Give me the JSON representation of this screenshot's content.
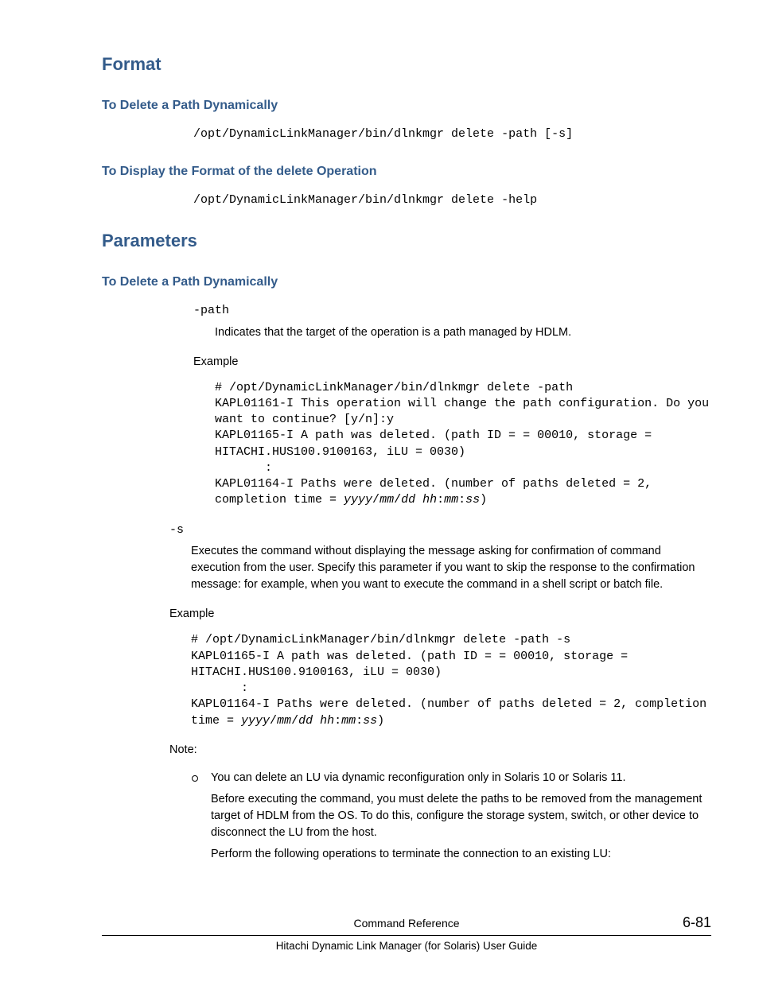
{
  "sections": {
    "format": {
      "title": "Format",
      "sub1": {
        "title": "To Delete a Path Dynamically",
        "code": "/opt/DynamicLinkManager/bin/dlnkmgr delete -path [-s]"
      },
      "sub2": {
        "title": "To Display the Format of the delete Operation",
        "code": "/opt/DynamicLinkManager/bin/dlnkmgr delete -help"
      }
    },
    "parameters": {
      "title": "Parameters",
      "sub1": {
        "title": "To Delete a Path Dynamically",
        "path": {
          "term": "-path",
          "desc": "Indicates that the target of the operation is a path managed by HDLM.",
          "example_label": "Example",
          "example_pre": "# /opt/DynamicLinkManager/bin/dlnkmgr delete -path\nKAPL01161-I This operation will change the path configuration. Do you want to continue? [y/n]:y\nKAPL01165-I A path was deleted. (path ID = = 00010, storage = HITACHI.HUS100.9100163, iLU = 0030)\n       :\nKAPL01164-I Paths were deleted. (number of paths deleted = 2, completion time = ",
          "example_it": "yyyy",
          "slash": "/",
          "example_it2": "mm",
          "example_it3": "dd hh",
          "colon": ":",
          "example_it4": "mm",
          "example_it5": "ss",
          "example_post": ")"
        },
        "s": {
          "term": "-s",
          "desc": "Executes the command without displaying the message asking for confirmation of command execution from the user. Specify this parameter if you want to skip the response to the confirmation message: for example, when you want to execute the command in a shell script or batch file.",
          "example_label": "Example",
          "example_pre": "# /opt/DynamicLinkManager/bin/dlnkmgr delete -path -s\nKAPL01165-I A path was deleted. (path ID = = 00010, storage = HITACHI.HUS100.9100163, iLU = 0030)\n       :\nKAPL01164-I Paths were deleted. (number of paths deleted = 2, completion time = ",
          "example_it": "yyyy",
          "slash": "/",
          "example_it2": "mm",
          "example_it3": "dd hh",
          "colon": ":",
          "example_it4": "mm",
          "example_it5": "ss",
          "example_post": ")"
        },
        "note": {
          "label": "Note:",
          "item1": "You can delete an LU via dynamic reconfiguration only in Solaris 10 or Solaris 11.",
          "item1p2": "Before executing the command, you must delete the paths to be removed from the management target of HDLM from the OS. To do this, configure the storage system, switch, or other device to disconnect the LU from the host.",
          "item1p3": "Perform the following operations to terminate the connection to an existing LU:"
        }
      }
    }
  },
  "footer": {
    "center": "Command Reference",
    "page": "6-81",
    "bottom": "Hitachi Dynamic Link Manager (for Solaris) User Guide"
  }
}
